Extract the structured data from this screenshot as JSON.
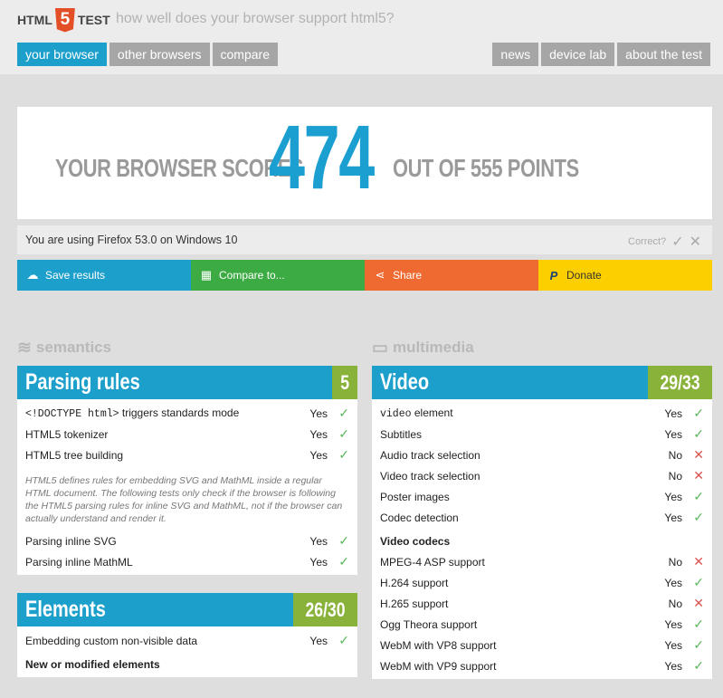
{
  "header": {
    "logo_left": "HTML",
    "logo_badge": "5",
    "logo_right": "TEST",
    "tagline": "how well does your browser support html5?"
  },
  "nav": {
    "left": [
      {
        "label": "your browser",
        "active": true
      },
      {
        "label": "other browsers",
        "active": false
      },
      {
        "label": "compare",
        "active": false
      }
    ],
    "right": [
      {
        "label": "news"
      },
      {
        "label": "device lab"
      },
      {
        "label": "about the test"
      }
    ]
  },
  "score": {
    "prefix": "YOUR BROWSER SCORES",
    "value": "474",
    "suffix": "OUT OF 555 POINTS"
  },
  "ua": {
    "text": "You are using Firefox 53.0 on Windows 10",
    "correct_label": "Correct?",
    "confirm_glyph": "✓",
    "reject_glyph": "✕"
  },
  "actions": [
    {
      "label": "Save results",
      "icon": "cloud-upload-icon",
      "glyph": "☁"
    },
    {
      "label": "Compare to...",
      "icon": "grid-icon",
      "glyph": "▦"
    },
    {
      "label": "Share",
      "icon": "share-icon",
      "glyph": "⋖"
    },
    {
      "label": "Donate",
      "icon": "paypal-icon",
      "glyph": "P"
    }
  ],
  "left_column": {
    "category": "semantics",
    "category_icon": "layers-icon",
    "parsing": {
      "title": "Parsing rules",
      "score": "5",
      "rows": [
        {
          "pre": "",
          "code": "<!DOCTYPE html>",
          "post": " triggers standards mode",
          "result": "Yes",
          "pass": true
        },
        {
          "pre": "HTML5 tokenizer",
          "code": "",
          "post": "",
          "result": "Yes",
          "pass": true
        },
        {
          "pre": "HTML5 tree building",
          "code": "",
          "post": "",
          "result": "Yes",
          "pass": true
        }
      ],
      "note": "HTML5 defines rules for embedding SVG and MathML inside a regular HTML document. The following tests only check if the browser is following the HTML5 parsing rules for inline SVG and MathML, not if the browser can actually understand and render it.",
      "rows2": [
        {
          "label": "Parsing inline SVG",
          "result": "Yes",
          "pass": true
        },
        {
          "label": "Parsing inline MathML",
          "result": "Yes",
          "pass": true
        }
      ]
    },
    "elements": {
      "title": "Elements",
      "score": "26/30",
      "rows": [
        {
          "label": "Embedding custom non-visible data",
          "result": "Yes",
          "pass": true
        }
      ],
      "subhead": "New or modified elements"
    }
  },
  "right_column": {
    "category": "multimedia",
    "category_icon": "film-icon",
    "video": {
      "title": "Video",
      "score": "29/33",
      "rows": [
        {
          "code": "video",
          "label": " element",
          "result": "Yes",
          "pass": true
        },
        {
          "code": "",
          "label": "Subtitles",
          "result": "Yes",
          "pass": true
        },
        {
          "code": "",
          "label": "Audio track selection",
          "result": "No",
          "pass": false
        },
        {
          "code": "",
          "label": "Video track selection",
          "result": "No",
          "pass": false
        },
        {
          "code": "",
          "label": "Poster images",
          "result": "Yes",
          "pass": true
        },
        {
          "code": "",
          "label": "Codec detection",
          "result": "Yes",
          "pass": true
        }
      ],
      "subhead": "Video codecs",
      "codecs": [
        {
          "label": "MPEG-4 ASP support",
          "result": "No",
          "pass": false
        },
        {
          "label": "H.264 support",
          "result": "Yes",
          "pass": true
        },
        {
          "label": "H.265 support",
          "result": "No",
          "pass": false
        },
        {
          "label": "Ogg Theora support",
          "result": "Yes",
          "pass": true
        },
        {
          "label": "WebM with VP8 support",
          "result": "Yes",
          "pass": true
        },
        {
          "label": "WebM with VP9 support",
          "result": "Yes",
          "pass": true
        }
      ]
    }
  },
  "glyphs": {
    "yes": "✓",
    "no": "✕"
  }
}
